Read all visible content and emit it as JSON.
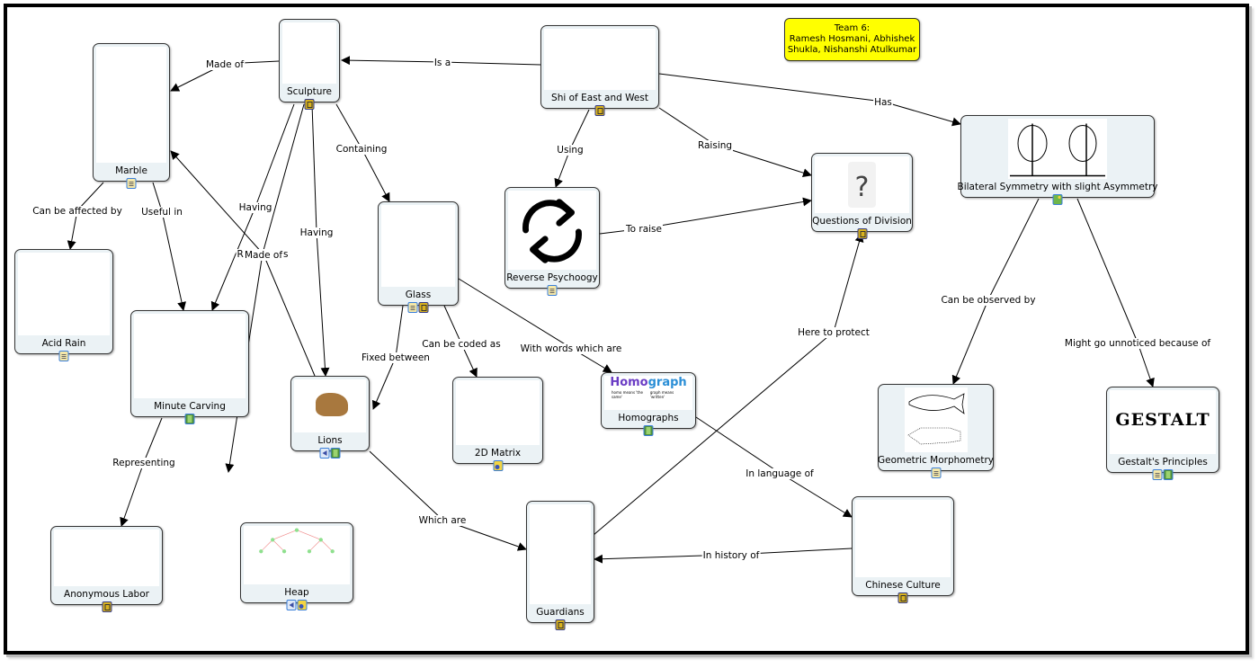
{
  "team_box": {
    "line1": "Team 6:",
    "line2": "Ramesh Hosmani, Abhishek",
    "line3": "Shukla, Nishanshi Atulkumar",
    "color": "#ffff00"
  },
  "nodes": {
    "marble": {
      "title": "Marble",
      "icons": [
        "cmap-doc-icon"
      ]
    },
    "sculpture": {
      "title": "Sculpture",
      "icons": [
        "cmap-icon"
      ]
    },
    "shi": {
      "title": "Shi of East and West",
      "icons": [
        "cmap-icon"
      ]
    },
    "acid_rain": {
      "title": "Acid Rain",
      "icons": [
        "cmap-doc-icon"
      ]
    },
    "minute_carving": {
      "title": "Minute Carving",
      "icons": [
        "video-icon"
      ]
    },
    "glass": {
      "title": "Glass",
      "icons": [
        "document-icon",
        "cmap-icon"
      ]
    },
    "reverse_psychology": {
      "title": "Reverse Psychoogy",
      "icons": [
        "document-icon"
      ]
    },
    "questions_of_division": {
      "title": "Questions of Division",
      "icons": [
        "cmap-icon"
      ]
    },
    "bilateral_symmetry": {
      "title": "Bilateral Symmetry with slight Asymmetry",
      "icons": [
        "image-icon"
      ]
    },
    "lions": {
      "title": "Lions",
      "icons": [
        "audio-icon",
        "video-icon"
      ]
    },
    "matrix_2d": {
      "title": "2D Matrix",
      "icons": [
        "resource-group-icon"
      ]
    },
    "homographs": {
      "title": "Homographs",
      "icons": [
        "video-icon"
      ]
    },
    "homograph_image": {
      "word_a": "Homo",
      "word_b": "graph",
      "note_a": "homo means 'the same'",
      "note_b": "graph means 'written'"
    },
    "geometric_morphometry": {
      "title": "Geometric Morphometry",
      "icons": [
        "document-icon"
      ]
    },
    "gestalt": {
      "title": "Gestalt's Principles",
      "image_text": "GESTALT",
      "icons": [
        "cmap-doc-icon",
        "video-icon"
      ]
    },
    "anonymous_labor": {
      "title": "Anonymous Labor",
      "icons": [
        "cmap-icon"
      ]
    },
    "heap": {
      "title": "Heap",
      "icons": [
        "audio-icon",
        "resource-group-icon"
      ]
    },
    "guardians": {
      "title": "Guardians",
      "icons": [
        "cmap-icon"
      ]
    },
    "chinese_culture": {
      "title": "Chinese Culture",
      "icons": [
        "cmap-icon"
      ]
    }
  },
  "links": [
    {
      "label": "Is a",
      "from": "Shi of East and West",
      "to": "Sculpture"
    },
    {
      "label": "Made of",
      "from": "Sculpture",
      "to": "Marble"
    },
    {
      "label": "Has",
      "from": "Shi of East and West",
      "to": "Bilateral Symmetry with slight Asymmetry"
    },
    {
      "label": "Using",
      "from": "Shi of East and West",
      "to": "Reverse Psychoogy"
    },
    {
      "label": "Raising",
      "from": "Shi of East and West",
      "to": "Questions of Division"
    },
    {
      "label": "To raise",
      "from": "Reverse Psychoogy",
      "to": "Questions of Division"
    },
    {
      "label": "Containing",
      "from": "Sculpture",
      "to": "Glass"
    },
    {
      "label": "Having",
      "from": "Sculpture",
      "to": "Minute Carving"
    },
    {
      "label": "Having",
      "from": "Sculpture",
      "to": "Lions"
    },
    {
      "label": "Resembels",
      "from": "Sculpture",
      "to": "Heap"
    },
    {
      "label": "Made of",
      "from": "Lions",
      "to": "Marble"
    },
    {
      "label": "Can be affected by",
      "from": "Marble",
      "to": "Acid Rain"
    },
    {
      "label": "Useful in",
      "from": "Marble",
      "to": "Minute Carving"
    },
    {
      "label": "Representing",
      "from": "Minute Carving",
      "to": "Anonymous Labor"
    },
    {
      "label": "Fixed between",
      "from": "Glass",
      "to": "Lions"
    },
    {
      "label": "Can be coded as",
      "from": "Glass",
      "to": "2D Matrix"
    },
    {
      "label": "With words which are",
      "from": "Glass",
      "to": "Homographs"
    },
    {
      "label": "Which are",
      "from": "Lions",
      "to": "Guardians"
    },
    {
      "label": "Here to protect",
      "from": "Guardians",
      "to": "Questions of Division"
    },
    {
      "label": "In language of",
      "from": "Homographs",
      "to": "Chinese Culture"
    },
    {
      "label": "In history of",
      "from": "Chinese Culture",
      "to": "Guardians"
    },
    {
      "label": "Can be observed by",
      "from": "Bilateral Symmetry with slight Asymmetry",
      "to": "Geometric Morphometry"
    },
    {
      "label": "Might go unnoticed because of",
      "from": "Bilateral Symmetry with slight Asymmetry",
      "to": "Gestalt's Principles"
    }
  ]
}
